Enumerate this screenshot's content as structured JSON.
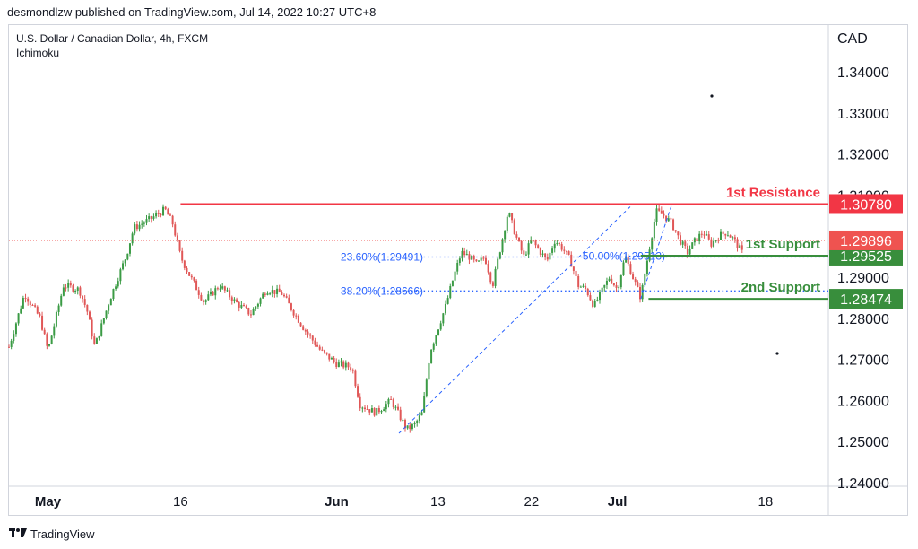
{
  "header": {
    "published_text": "desmondlzw published on TradingView.com, Jul 14, 2022 10:27 UTC+8"
  },
  "symbol": {
    "title": "U.S. Dollar / Canadian Dollar, 4h, FXCM",
    "indicator": "Ichimoku"
  },
  "footer": {
    "brand": "TradingView"
  },
  "colors": {
    "up": "#26a69a",
    "up_candle": "#3b9b45",
    "down": "#e05757",
    "resistance": "#f23645",
    "support": "#388e3c",
    "fib": "#2962ff",
    "current_price": "#ef5350"
  },
  "chart_data": {
    "type": "candlestick",
    "currency": "CAD",
    "ylim": [
      1.24,
      1.35
    ],
    "y_ticks": [
      "1.34000",
      "1.33000",
      "1.32000",
      "1.31000",
      "1.30000",
      "1.29000",
      "1.28000",
      "1.27000",
      "1.26000",
      "1.25000",
      "1.24000"
    ],
    "x_ticks": [
      {
        "label": "May",
        "bold": true,
        "t": 0.05
      },
      {
        "label": "16",
        "bold": false,
        "t": 0.22
      },
      {
        "label": "Jun",
        "bold": true,
        "t": 0.42
      },
      {
        "label": "13",
        "bold": false,
        "t": 0.55
      },
      {
        "label": "22",
        "bold": false,
        "t": 0.67
      },
      {
        "label": "Jul",
        "bold": true,
        "t": 0.78
      },
      {
        "label": "18",
        "bold": false,
        "t": 0.97
      }
    ],
    "levels": [
      {
        "name": "1st Resistance",
        "price": 1.3078,
        "price_label": "1.30780",
        "color": "#f23645"
      },
      {
        "name": "1st Support",
        "price": 1.29525,
        "price_label": "1.29525",
        "color": "#388e3c"
      },
      {
        "name": "2nd Support",
        "price": 1.28474,
        "price_label": "1.28474",
        "color": "#388e3c"
      }
    ],
    "current_price": {
      "price": 1.29896,
      "price_label": "1.29896"
    },
    "fib_levels": [
      {
        "label": "23.60%(1.29491)",
        "price": 1.29491
      },
      {
        "label": "38.20%(1.28666)",
        "price": 1.28666
      },
      {
        "label": "50.00%(1.29513)",
        "price": 1.29513
      }
    ],
    "price_path": [
      [
        0.0,
        1.273
      ],
      [
        0.02,
        1.286
      ],
      [
        0.04,
        1.28
      ],
      [
        0.05,
        1.272
      ],
      [
        0.07,
        1.288
      ],
      [
        0.09,
        1.287
      ],
      [
        0.1,
        1.282
      ],
      [
        0.11,
        1.273
      ],
      [
        0.13,
        1.285
      ],
      [
        0.15,
        1.295
      ],
      [
        0.16,
        1.302
      ],
      [
        0.18,
        1.304
      ],
      [
        0.2,
        1.3065
      ],
      [
        0.21,
        1.303
      ],
      [
        0.22,
        1.295
      ],
      [
        0.23,
        1.291
      ],
      [
        0.25,
        1.284
      ],
      [
        0.27,
        1.288
      ],
      [
        0.29,
        1.284
      ],
      [
        0.31,
        1.281
      ],
      [
        0.33,
        1.287
      ],
      [
        0.35,
        1.286
      ],
      [
        0.37,
        1.28
      ],
      [
        0.38,
        1.277
      ],
      [
        0.4,
        1.272
      ],
      [
        0.42,
        1.269
      ],
      [
        0.44,
        1.268
      ],
      [
        0.45,
        1.259
      ],
      [
        0.47,
        1.257
      ],
      [
        0.49,
        1.26
      ],
      [
        0.51,
        1.253
      ],
      [
        0.52,
        1.254
      ],
      [
        0.53,
        1.257
      ],
      [
        0.54,
        1.272
      ],
      [
        0.56,
        1.283
      ],
      [
        0.57,
        1.29
      ],
      [
        0.58,
        1.296
      ],
      [
        0.59,
        1.295
      ],
      [
        0.6,
        1.293
      ],
      [
        0.61,
        1.295
      ],
      [
        0.62,
        1.288
      ],
      [
        0.63,
        1.297
      ],
      [
        0.64,
        1.306
      ],
      [
        0.65,
        1.3
      ],
      [
        0.66,
        1.295
      ],
      [
        0.67,
        1.299
      ],
      [
        0.69,
        1.294
      ],
      [
        0.7,
        1.299
      ],
      [
        0.71,
        1.297
      ],
      [
        0.72,
        1.294
      ],
      [
        0.73,
        1.288
      ],
      [
        0.74,
        1.287
      ],
      [
        0.75,
        1.283
      ],
      [
        0.77,
        1.29
      ],
      [
        0.78,
        1.287
      ],
      [
        0.79,
        1.295
      ],
      [
        0.8,
        1.29
      ],
      [
        0.81,
        1.285
      ],
      [
        0.82,
        1.296
      ],
      [
        0.83,
        1.306
      ],
      [
        0.84,
        1.305
      ],
      [
        0.85,
        1.303
      ],
      [
        0.86,
        1.299
      ],
      [
        0.87,
        1.296
      ],
      [
        0.88,
        1.299
      ],
      [
        0.89,
        1.301
      ],
      [
        0.9,
        1.298
      ],
      [
        0.91,
        1.3
      ],
      [
        0.92,
        1.301
      ],
      [
        0.93,
        1.299
      ],
      [
        0.94,
        1.296
      ]
    ]
  }
}
